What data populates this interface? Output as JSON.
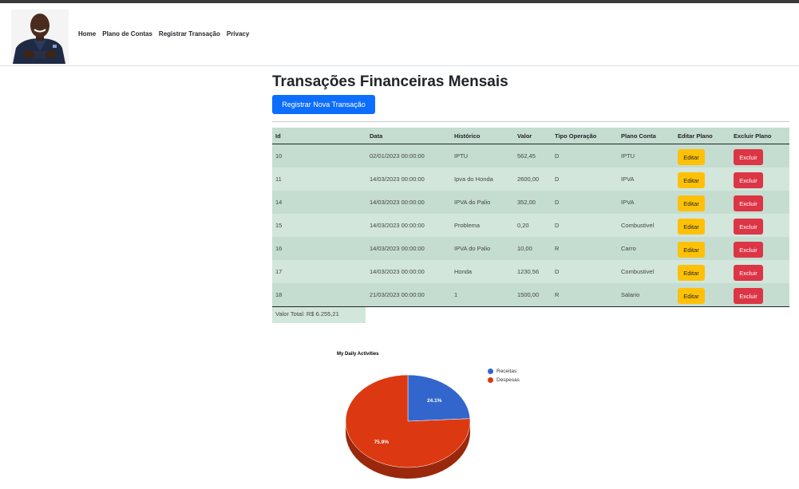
{
  "nav": {
    "links": [
      "Home",
      "Plano de Contas",
      "Registrar Transação",
      "Privacy"
    ]
  },
  "main": {
    "title": "Transações Financeiras Mensais",
    "new_button": "Registrar Nova Transação",
    "total": "Valor Total: R$ 6.255,21"
  },
  "table": {
    "headers": [
      "Id",
      "Data",
      "Histórico",
      "Valor",
      "Tipo Operação",
      "Plano Conta",
      "Editar Plano",
      "Excluir Plano"
    ],
    "edit_label": "Editar",
    "delete_label": "Excluir",
    "rows": [
      {
        "id": "10",
        "data": "02/01/2023 00:00:00",
        "historico": "IPTU",
        "valor": "562,45",
        "tipo": "D",
        "plano": "IPTU"
      },
      {
        "id": "11",
        "data": "14/03/2023 00:00:00",
        "historico": "Ipva do Honda",
        "valor": "2600,00",
        "tipo": "D",
        "plano": "IPVA"
      },
      {
        "id": "14",
        "data": "14/03/2023 00:00:00",
        "historico": "IPVA do Palio",
        "valor": "352,00",
        "tipo": "D",
        "plano": "IPVA"
      },
      {
        "id": "15",
        "data": "14/03/2023 00:00:00",
        "historico": "Problema",
        "valor": "0,20",
        "tipo": "D",
        "plano": "Combustivel"
      },
      {
        "id": "16",
        "data": "14/03/2023 00:00:00",
        "historico": "IPVA do Palio",
        "valor": "10,00",
        "tipo": "R",
        "plano": "Carro"
      },
      {
        "id": "17",
        "data": "14/03/2023 00:00:00",
        "historico": "Honda",
        "valor": "1230,56",
        "tipo": "D",
        "plano": "Combustivel"
      },
      {
        "id": "18",
        "data": "21/03/2023 00:00:00",
        "historico": "1",
        "valor": "1500,00",
        "tipo": "R",
        "plano": "Salario"
      }
    ]
  },
  "colors": {
    "primary": "#0d6efd",
    "warning": "#ffc107",
    "danger": "#dc3545",
    "row_odd": "#c5ddd0",
    "row_even": "#d2e6db"
  },
  "chart_data": {
    "type": "pie",
    "title": "My Daily Activities",
    "labels": [
      "Receitas",
      "Despesas"
    ],
    "values": [
      24.1,
      75.9
    ],
    "value_labels": [
      "24.1%",
      "75.9%"
    ],
    "colors": [
      "#3366cc",
      "#dc3912"
    ],
    "is3D": true,
    "legend": "right"
  }
}
